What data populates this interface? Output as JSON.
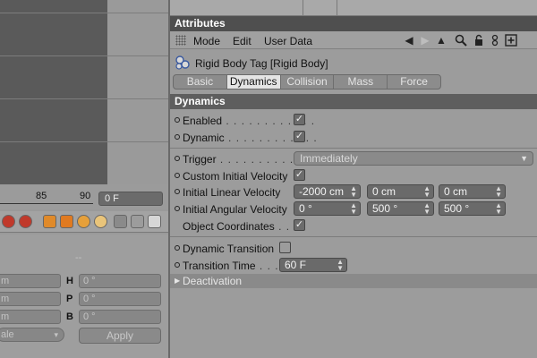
{
  "timeline": {
    "ticks": [
      "85",
      "90"
    ],
    "current_frame": "0 F"
  },
  "coords": {
    "header": "--",
    "rot_labels": [
      "H",
      "P",
      "B"
    ],
    "pos_values": [
      "m",
      "m",
      "m"
    ],
    "rot_values": [
      "0 °",
      "0 °",
      "0 °"
    ],
    "scale_mode": "ale",
    "apply_label": "Apply"
  },
  "attributes": {
    "title": "Attributes",
    "menu": [
      "Mode",
      "Edit",
      "User Data"
    ],
    "object_name": "Rigid Body Tag [Rigid Body]",
    "tabs": [
      "Basic",
      "Dynamics",
      "Collision",
      "Mass",
      "Force"
    ],
    "active_tab": "Dynamics",
    "section": "Dynamics",
    "enabled": {
      "label": "Enabled",
      "dots": " . . . . . . . . . . . .",
      "checked": true
    },
    "dynamic": {
      "label": "Dynamic",
      "dots": " . . . . . . . . . . . .",
      "checked": true
    },
    "trigger": {
      "label": "Trigger",
      "dots": " . . . . . . . . . . . . .",
      "value": "Immediately"
    },
    "custom_initial_velocity": {
      "label": "Custom Initial Velocity",
      "checked": true
    },
    "initial_linear_velocity": {
      "label": "Initial Linear Velocity",
      "values": [
        "-2000 cm",
        "0 cm",
        "0 cm"
      ]
    },
    "initial_angular_velocity": {
      "label": "Initial Angular Velocity",
      "values": [
        "0 °",
        "500 °",
        "500 °"
      ]
    },
    "object_coordinates": {
      "label": "Object Coordinates",
      "dots": " . .",
      "checked": true
    },
    "dynamic_transition": {
      "label": "Dynamic Transition",
      "checked": false
    },
    "transition_time": {
      "label": "Transition Time",
      "dots": " . . . .",
      "value": "60 F"
    },
    "deactivation": "Deactivation"
  },
  "colors": {
    "title_bar": "#4f4f4f",
    "section_bar": "#5e5e5e",
    "active_tab": "#e4e4e4"
  }
}
